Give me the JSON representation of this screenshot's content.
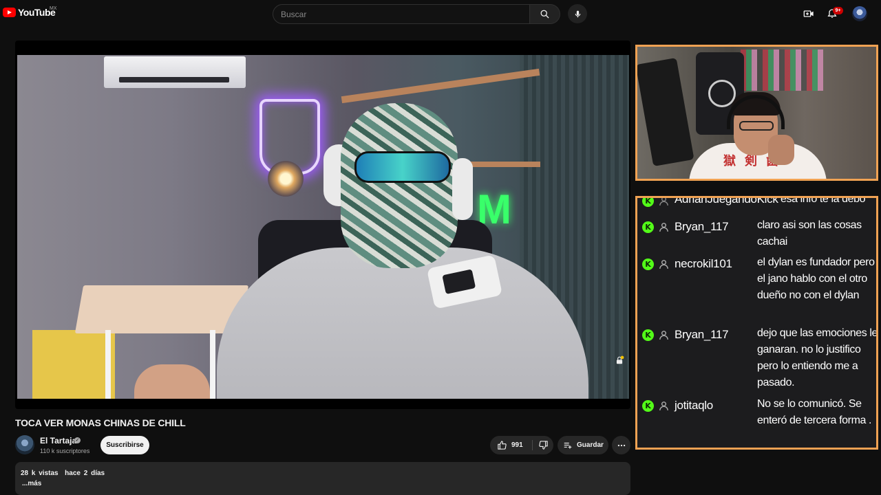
{
  "header": {
    "logo_text": "YouTube",
    "logo_country": "MX",
    "search_placeholder": "Buscar",
    "notifications_badge": "9+"
  },
  "video": {
    "title": "TOCA VER MONAS CHINAS DE CHILL",
    "channel_name": "El Tartaja",
    "subscribers": "110 k suscriptores",
    "subscribe_label": "Suscribirse",
    "likes": "991",
    "save_label": "Guardar",
    "views": "28 k vistas",
    "uploaded": "hace 2 días",
    "more_label": "...más"
  },
  "stream_chat": {
    "border_color": "#f0a253",
    "messages": [
      {
        "user": "AdrianJuegandoKick",
        "text": "esa info te la debo"
      },
      {
        "user": "Bryan_117",
        "text": "claro asi son las cosas cachai"
      },
      {
        "user": "necrokil101",
        "text": "el dylan es fundador pero el jano hablo con el otro dueño no con el dylan"
      },
      {
        "user": "Bryan_117",
        "text": "dejo que las emociones le ganaran. no lo justifico pero lo entiendo me a pasado."
      },
      {
        "user": "jotitaqlo",
        "text": "No se lo comunicó. Se enteró de tercera forma ."
      }
    ]
  },
  "colors": {
    "brand_red": "#ff0000",
    "kick_green": "#53fc18",
    "overlay_border": "#f0a253"
  }
}
